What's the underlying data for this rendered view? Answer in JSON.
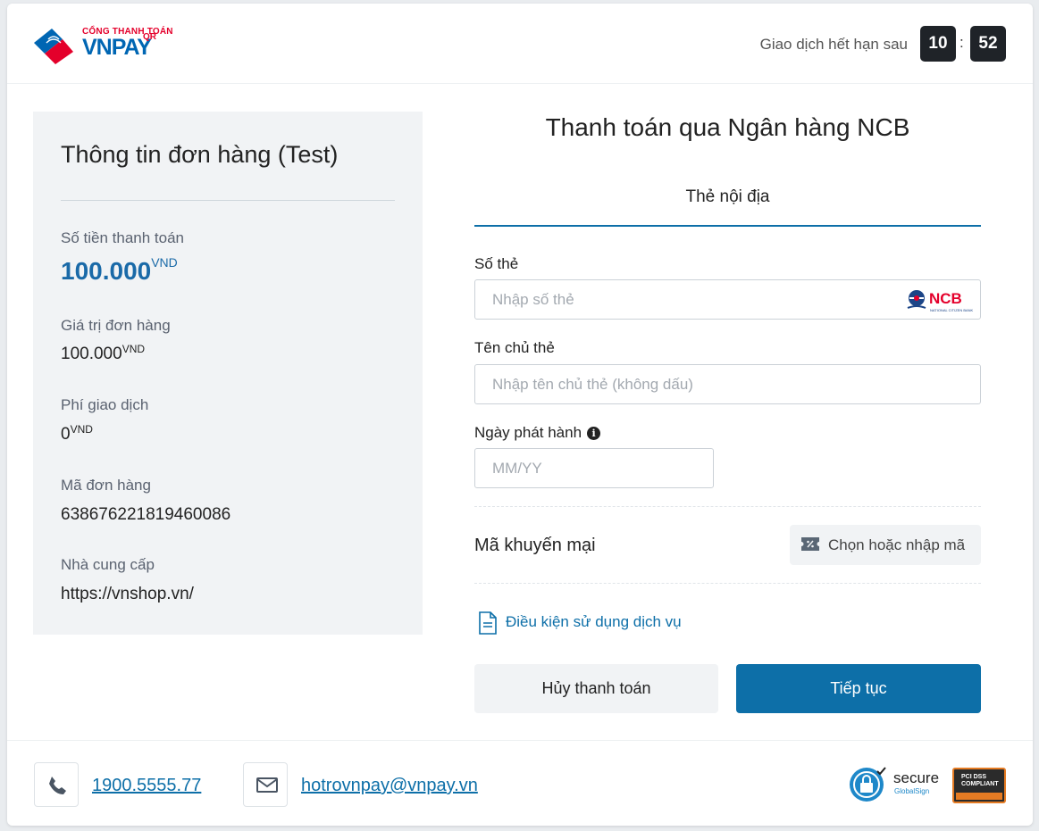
{
  "header": {
    "logo_subtitle": "CỔNG THANH TOÁN",
    "logo_main": "VNPAY",
    "logo_qr": "QR",
    "expire_label": "Giao dịch hết hạn sau",
    "timer_minutes": "10",
    "timer_separator": ":",
    "timer_seconds": "52"
  },
  "order": {
    "title": "Thông tin đơn hàng (Test)",
    "amount_label": "Số tiền thanh toán",
    "amount_value": "100.000",
    "amount_currency": "VND",
    "order_value_label": "Giá trị đơn hàng",
    "order_value": "100.000",
    "order_value_currency": "VND",
    "fee_label": "Phí giao dịch",
    "fee_value": "0",
    "fee_currency": "VND",
    "order_id_label": "Mã đơn hàng",
    "order_id": "638676221819460086",
    "provider_label": "Nhà cung cấp",
    "provider": "https://vnshop.vn/"
  },
  "payment": {
    "title": "Thanh toán qua Ngân hàng NCB",
    "tab_label": "Thẻ nội địa",
    "card_number_label": "Số thẻ",
    "card_number_placeholder": "Nhập số thẻ",
    "bank_logo_text": "NCB",
    "bank_logo_subtext": "NATIONAL CITIZEN BANK",
    "holder_label": "Tên chủ thẻ",
    "holder_placeholder": "Nhập tên chủ thẻ (không dấu)",
    "issue_date_label": "Ngày phát hành",
    "issue_date_info_icon": "i",
    "issue_date_placeholder": "MM/YY",
    "promo_label": "Mã khuyến mại",
    "promo_button": "Chọn hoặc nhập mã",
    "terms_link": "Điều kiện sử dụng dịch vụ",
    "cancel_button": "Hủy thanh toán",
    "continue_button": "Tiếp tục"
  },
  "footer": {
    "phone": "1900.5555.77",
    "email": "hotrovnpay@vnpay.vn",
    "secure_badge_text": "secure",
    "secure_badge_sub": "GlobalSign",
    "pci_text": "PCI DSS COMPLIANT"
  },
  "colors": {
    "primary": "#0d6fa8",
    "timer_bg": "#1f2328",
    "panel_bg": "#f1f3f5",
    "brand_red": "#e4002b"
  }
}
